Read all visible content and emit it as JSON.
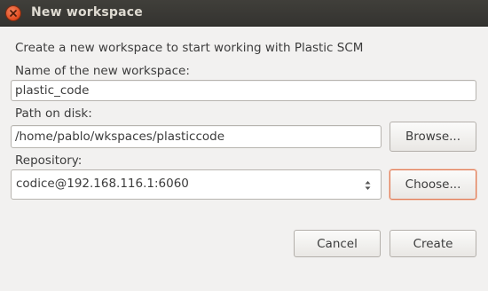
{
  "window": {
    "title": "New workspace",
    "accent_color": "#e0491d"
  },
  "intro_text": "Create a new workspace to start working with Plastic SCM",
  "name_field": {
    "label": "Name of the new workspace:",
    "value": "plastic_code"
  },
  "path_field": {
    "label": "Path on disk:",
    "value": "/home/pablo/wkspaces/plasticcode",
    "browse_label": "Browse..."
  },
  "repository_field": {
    "label": "Repository:",
    "selected": "codice@192.168.116.1:6060",
    "choose_label": "Choose..."
  },
  "actions": {
    "cancel_label": "Cancel",
    "create_label": "Create"
  }
}
